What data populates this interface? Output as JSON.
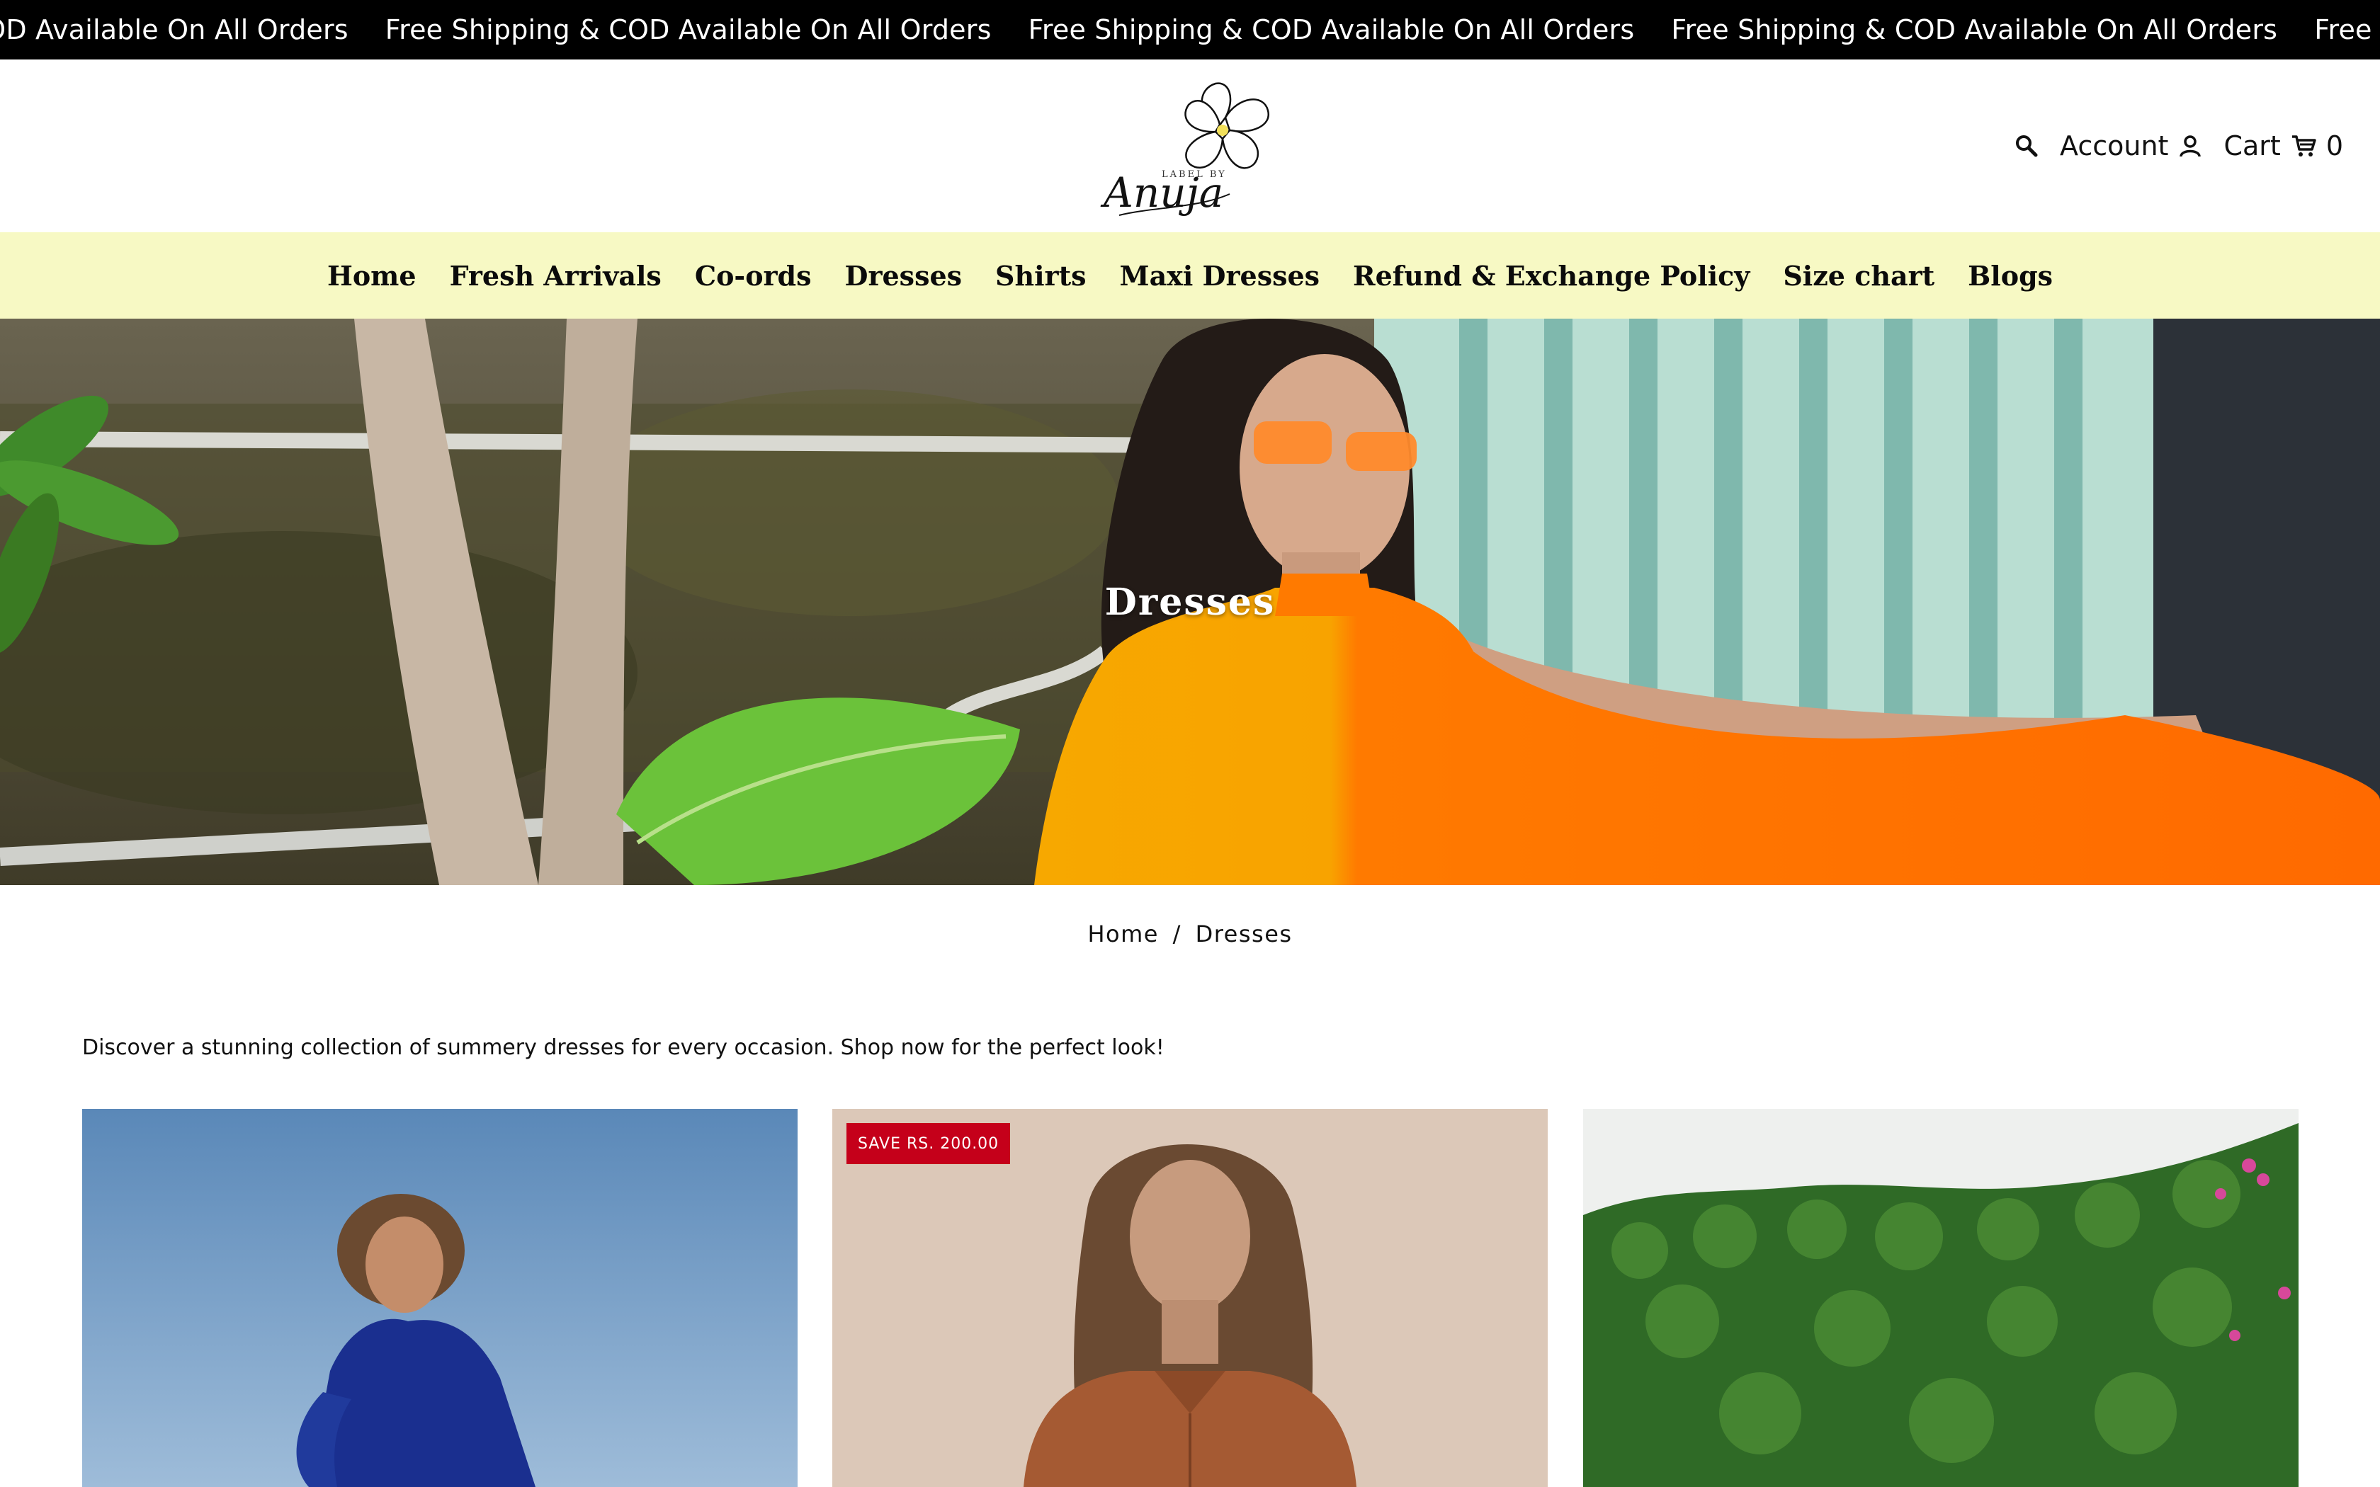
{
  "announcement": {
    "items": [
      "Free Shipping & COD Available On All Orders",
      "Free Shipping & COD Available On All Orders",
      "Free Shipping & COD Available On All Orders",
      "Free Shipping & COD Available On All Orders",
      "Free Shipping & COD Available On All Orders"
    ]
  },
  "header": {
    "logo": {
      "top_text": "LABEL BY",
      "script_text": "Anuja"
    },
    "search_icon": "search-icon",
    "account_label": "Account",
    "cart_label": "Cart",
    "cart_count": "0"
  },
  "nav": {
    "items": [
      "Home",
      "Fresh Arrivals",
      "Co-ords",
      "Dresses",
      "Shirts",
      "Maxi Dresses",
      "Refund & Exchange Policy",
      "Size chart",
      "Blogs"
    ]
  },
  "hero": {
    "title": "Dresses"
  },
  "breadcrumb": {
    "home": "Home",
    "separator": "/",
    "current": "Dresses"
  },
  "collection": {
    "description": "Discover a stunning collection of summery dresses for every occasion. Shop now for the perfect look!"
  },
  "products": [
    {
      "badge": ""
    },
    {
      "badge": "SAVE RS. 200.00"
    },
    {
      "badge": ""
    }
  ],
  "colors": {
    "announcement_bg": "#000000",
    "nav_bg": "#f7f9c4",
    "badge_bg": "#c5001a"
  }
}
